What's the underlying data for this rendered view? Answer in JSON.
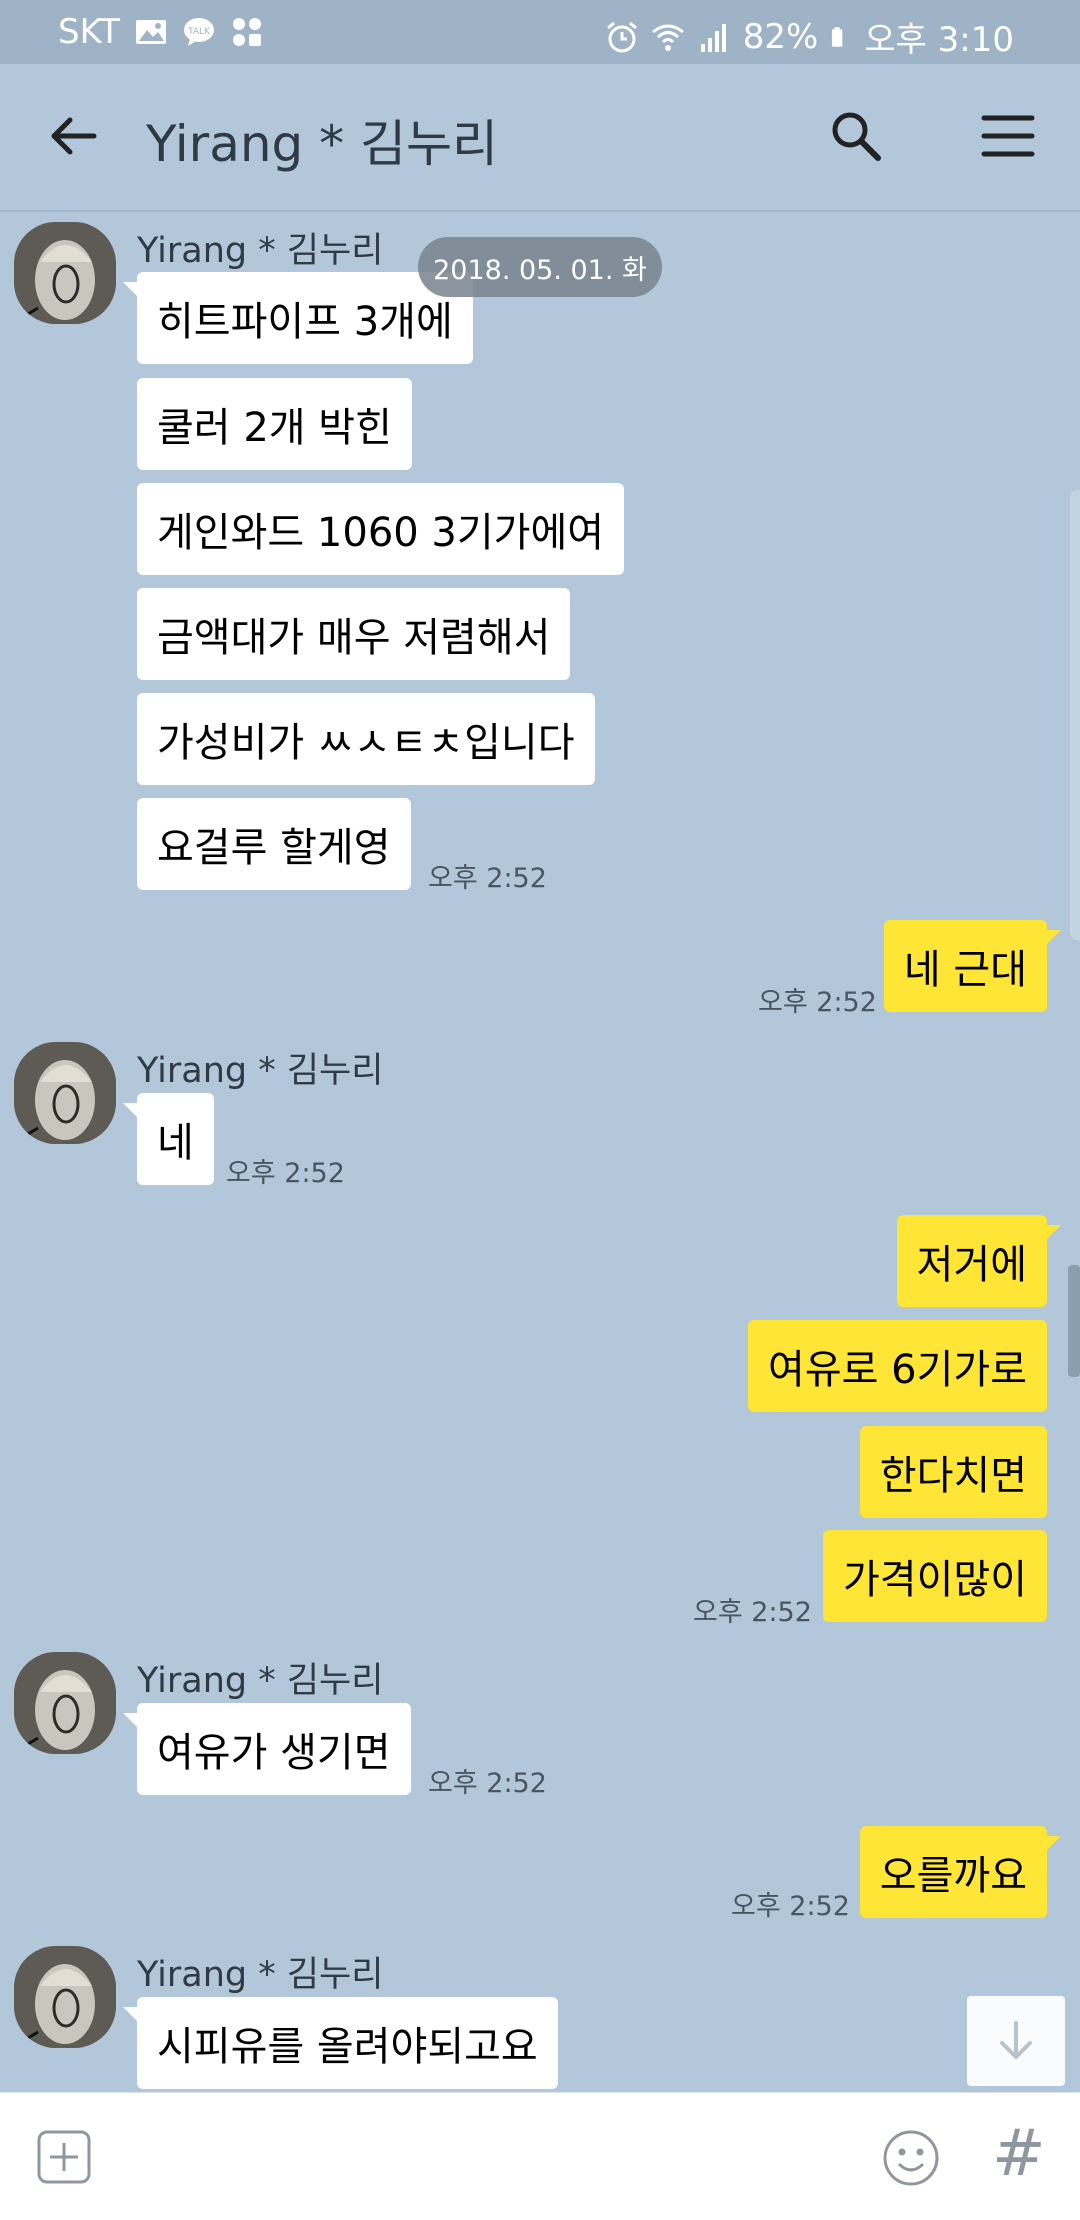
{
  "status_bar": {
    "carrier": "SKT",
    "battery": "82%",
    "time": "오후 3:10",
    "icons": [
      "gallery-icon",
      "talk-icon",
      "apps-icon",
      "alarm-icon",
      "wifi-icon",
      "signal-icon",
      "battery-icon"
    ]
  },
  "header": {
    "title": "Yirang * 김누리",
    "icons": [
      "back-arrow-icon",
      "search-icon",
      "menu-icon"
    ]
  },
  "chat": {
    "date_pill": "2018. 05. 01. 화",
    "sender_name": "Yirang * 김누리",
    "group1": {
      "messages": [
        "히트파이프 3개에",
        "쿨러 2개 박힌",
        "게인와드 1060 3기가에여",
        "금액대가 매우 저렴해서",
        "가성비가 ㅆㅅㅌㅊ입니다",
        "요걸루 할게영"
      ],
      "time": "오후 2:52"
    },
    "mine1": {
      "messages": [
        "네 근대"
      ],
      "time": "오후 2:52"
    },
    "group2": {
      "messages": [
        "네"
      ],
      "time": "오후 2:52"
    },
    "mine2": {
      "messages": [
        "저거에",
        "여유로 6기가로",
        "한다치면",
        "가격이많이"
      ],
      "time": "오후 2:52"
    },
    "group3": {
      "messages": [
        "여유가 생기면"
      ],
      "time": "오후 2:52"
    },
    "mine3": {
      "messages": [
        "오를까요"
      ],
      "time": "오후 2:52"
    },
    "group4": {
      "messages": [
        "시피유를 올려야되고요"
      ]
    }
  },
  "input_bar": {
    "icons": [
      "plus-icon",
      "emoji-icon"
    ],
    "hash_label": "#"
  },
  "colors": {
    "background": "#b2c7da",
    "my_bubble": "#fee536",
    "their_bubble": "#ffffff"
  }
}
